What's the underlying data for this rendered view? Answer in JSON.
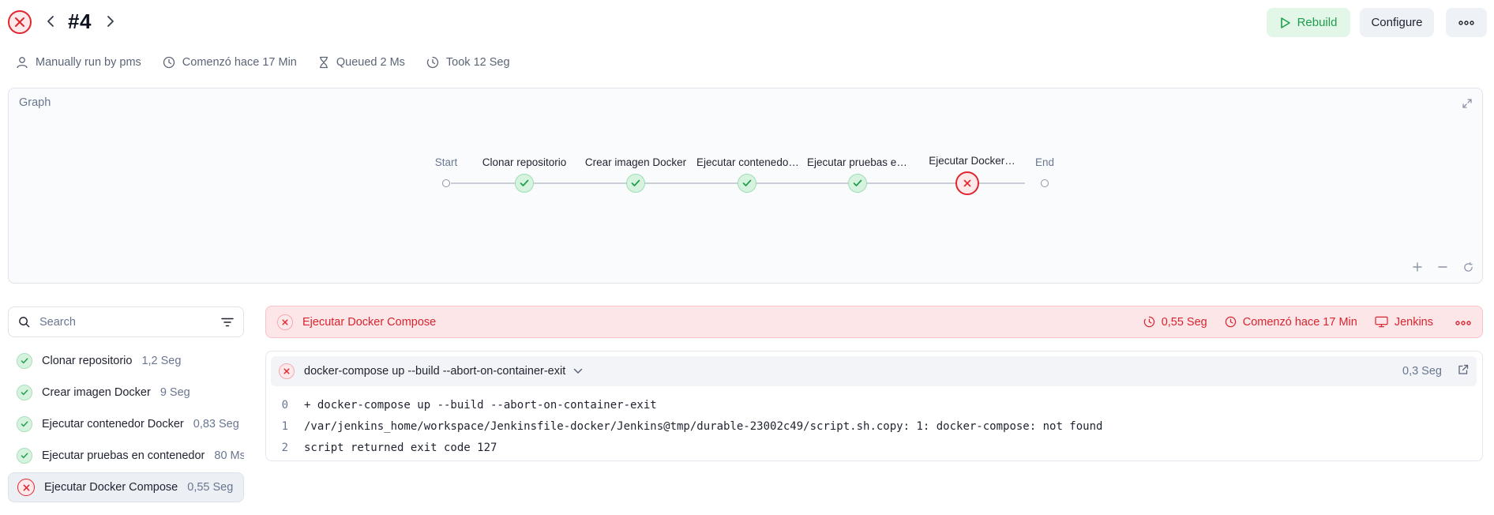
{
  "header": {
    "build_number": "#4",
    "rebuild_label": "Rebuild",
    "configure_label": "Configure",
    "more_label": "···"
  },
  "meta": {
    "run_by": "Manually run by pms",
    "started": "Comenzó hace 17 Min",
    "queued": "Queued 2 Ms",
    "took": "Took 12 Seg"
  },
  "graph": {
    "title": "Graph",
    "start_label": "Start",
    "end_label": "End",
    "stages": [
      {
        "label": "Clonar repositorio",
        "status": "success"
      },
      {
        "label": "Crear imagen Docker",
        "status": "success"
      },
      {
        "label": "Ejecutar contenedor…",
        "status": "success"
      },
      {
        "label": "Ejecutar pruebas en…",
        "status": "success"
      },
      {
        "label": "Ejecutar Docker…",
        "status": "failed"
      }
    ]
  },
  "search": {
    "placeholder": "Search"
  },
  "stage_list": [
    {
      "name": "Clonar repositorio",
      "duration": "1,2 Seg",
      "status": "success"
    },
    {
      "name": "Crear imagen Docker",
      "duration": "9 Seg",
      "status": "success"
    },
    {
      "name": "Ejecutar contenedor Docker",
      "duration": "0,83 Seg",
      "status": "success"
    },
    {
      "name": "Ejecutar pruebas en contenedor",
      "duration": "80 Ms",
      "status": "success"
    },
    {
      "name": "Ejecutar Docker Compose",
      "duration": "0,55 Seg",
      "status": "failed"
    }
  ],
  "stage_detail": {
    "title": "Ejecutar Docker Compose",
    "duration": "0,55 Seg",
    "started": "Comenzó hace 17 Min",
    "agent": "Jenkins"
  },
  "step": {
    "command": "docker-compose up --build --abort-on-container-exit",
    "duration": "0,3 Seg",
    "log": [
      {
        "num": "0",
        "text": "+ docker-compose up --build --abort-on-container-exit"
      },
      {
        "num": "1",
        "text": "/var/jenkins_home/workspace/Jenkinsfile-docker/Jenkins@tmp/durable-23002c49/script.sh.copy: 1: docker-compose: not found"
      },
      {
        "num": "2",
        "text": "script returned exit code 127"
      }
    ]
  },
  "colors": {
    "fail": "#e0262f",
    "success": "#1e9e4c",
    "fail_bg": "#fde6e8"
  }
}
